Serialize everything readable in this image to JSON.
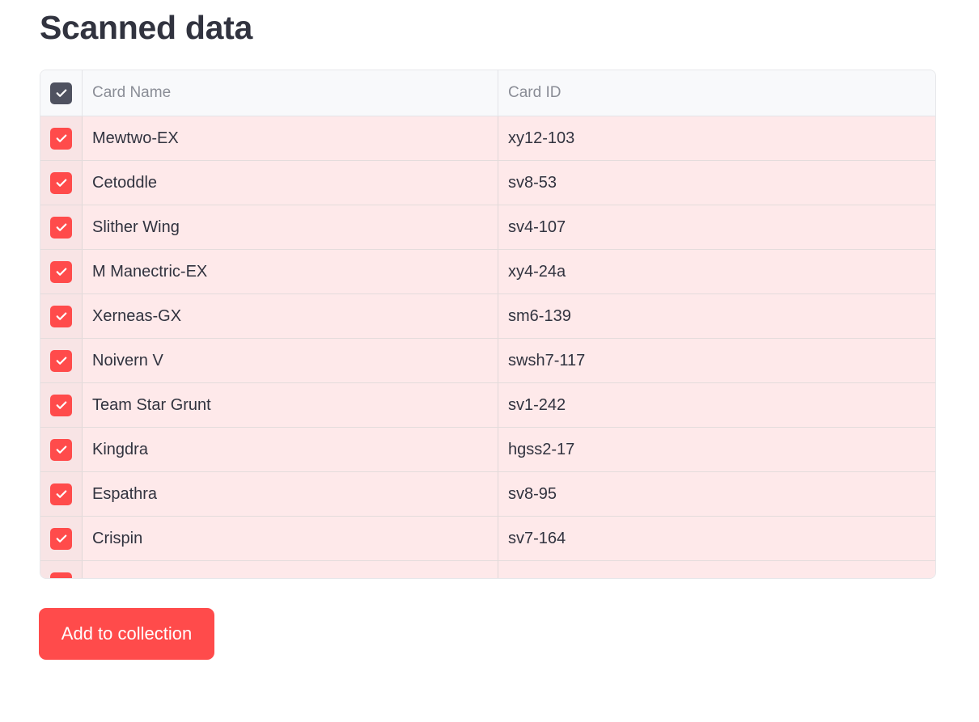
{
  "page": {
    "title": "Scanned data"
  },
  "table": {
    "columns": [
      "Card Name",
      "Card ID"
    ],
    "select_all_checked": true,
    "rows": [
      {
        "name": "Mewtwo-EX",
        "id": "xy12-103",
        "selected": true
      },
      {
        "name": "Cetoddle",
        "id": "sv8-53",
        "selected": true
      },
      {
        "name": "Slither Wing",
        "id": "sv4-107",
        "selected": true
      },
      {
        "name": "M Manectric-EX",
        "id": "xy4-24a",
        "selected": true
      },
      {
        "name": "Xerneas-GX",
        "id": "sm6-139",
        "selected": true
      },
      {
        "name": "Noivern V",
        "id": "swsh7-117",
        "selected": true
      },
      {
        "name": "Team Star Grunt",
        "id": "sv1-242",
        "selected": true
      },
      {
        "name": "Kingdra",
        "id": "hgss2-17",
        "selected": true
      },
      {
        "name": "Espathra",
        "id": "sv8-95",
        "selected": true
      },
      {
        "name": "Crispin",
        "id": "sv7-164",
        "selected": true
      }
    ]
  },
  "actions": {
    "add_label": "Add to collection"
  },
  "colors": {
    "accent": "#ff4b4b",
    "row_highlight": "#fee9ea",
    "header_bg": "#f8f9fb",
    "text": "#31333f"
  },
  "icons": {
    "checkbox": "check-icon"
  }
}
